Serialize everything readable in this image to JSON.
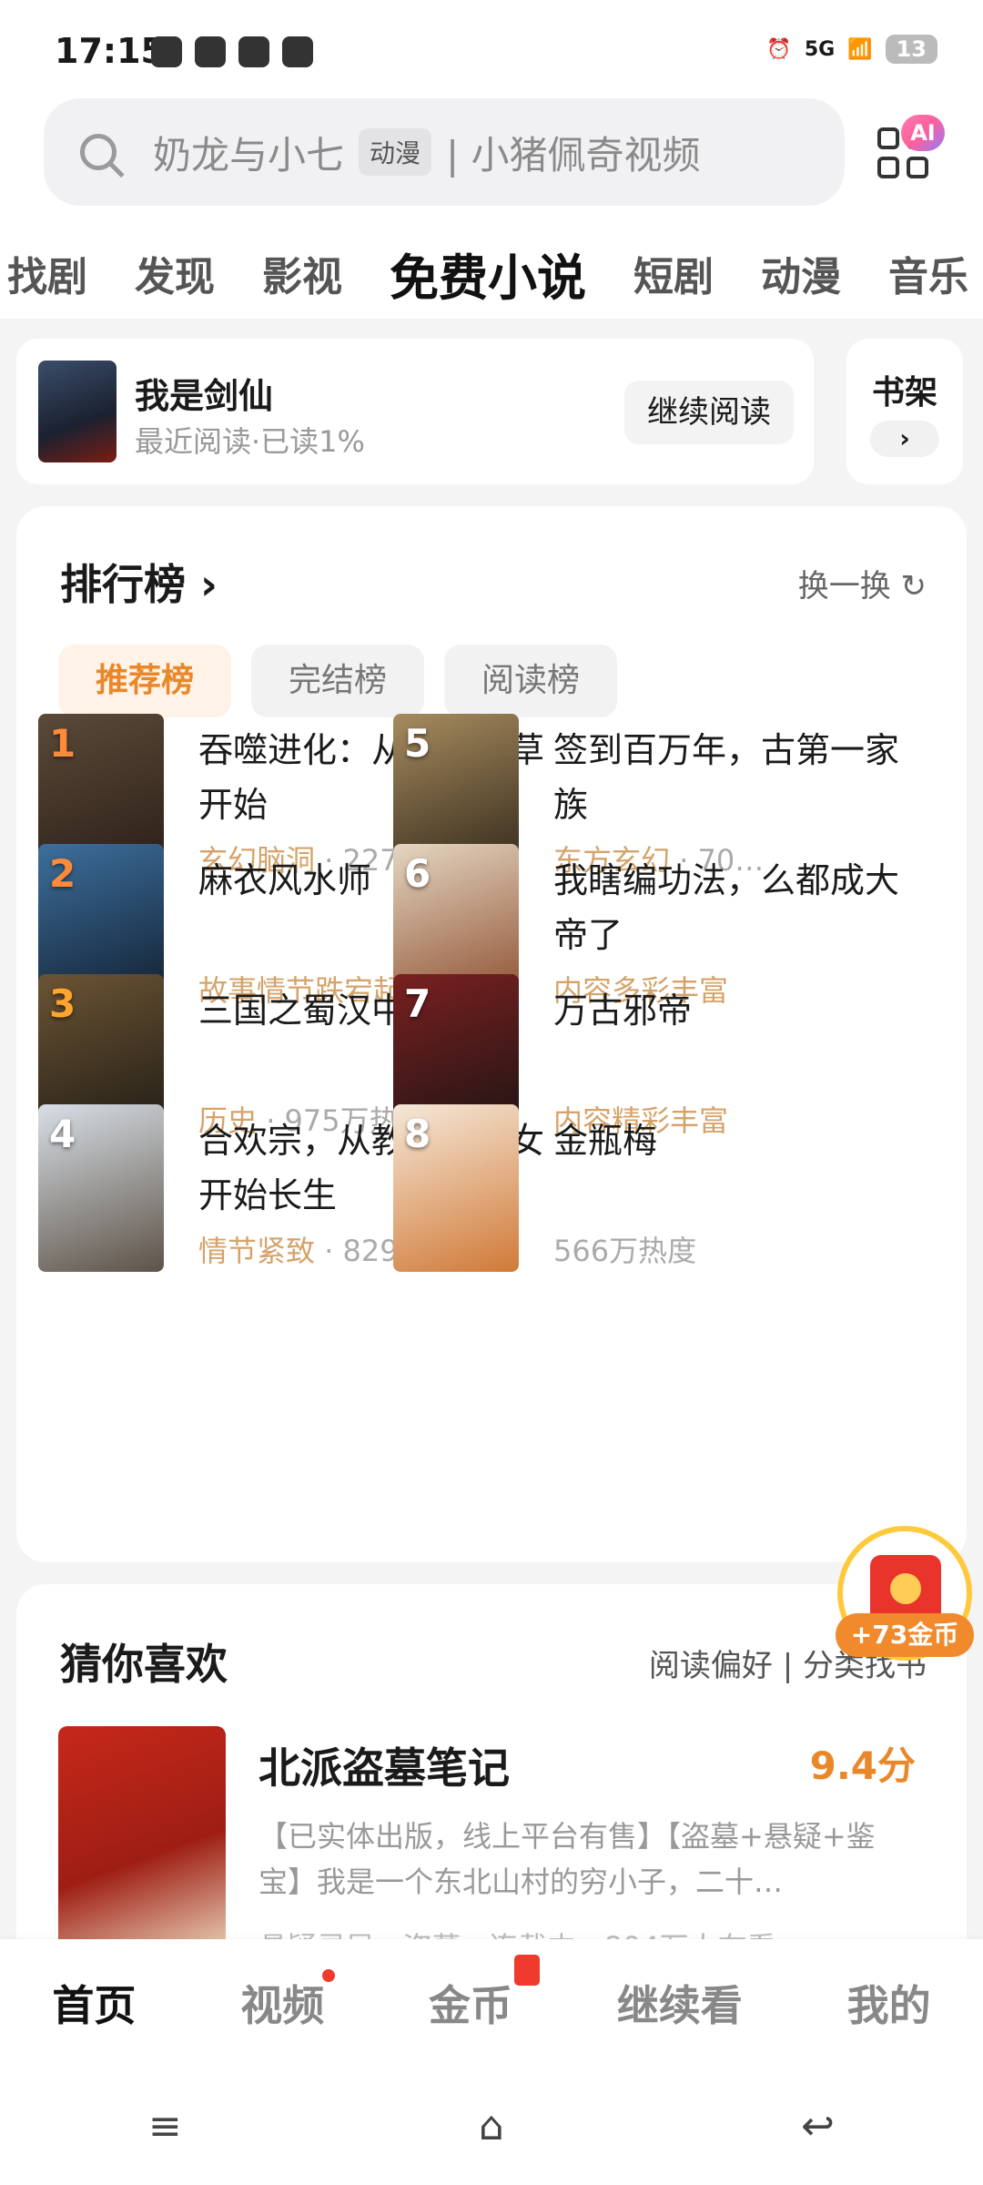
{
  "status_bar": {
    "time": "17:15",
    "network": "5G",
    "battery": "13"
  },
  "search": {
    "query": "奶龙与小七",
    "tag": "动漫",
    "hint": "| 小猪佩奇视频",
    "ai_badge": "AI"
  },
  "tabs": [
    "找剧",
    "发现",
    "影视",
    "免费小说",
    "短剧",
    "动漫",
    "音乐"
  ],
  "continue_reading": {
    "title": "我是剑仙",
    "subtitle": "最近阅读·已读1%",
    "button": "继续阅读"
  },
  "bookshelf": {
    "label": "书架",
    "chevron": "›"
  },
  "ranking": {
    "title": "排行榜 ›",
    "refresh": "换一换 ↻",
    "chips": [
      "推荐榜",
      "完结榜",
      "阅读榜"
    ],
    "books": [
      {
        "num": "1",
        "title": "吞噬进化：从一株杂草开始",
        "genre": "玄幻脑洞",
        "heat": " · 2273万热度",
        "c1": "#5a4a3a",
        "c2": "#2a1c14"
      },
      {
        "num": "2",
        "title": "麻衣风水师",
        "genre": "故事情节跌宕起伏",
        "heat": " · 1…",
        "c1": "#3d6f9c",
        "c2": "#101c2c"
      },
      {
        "num": "3",
        "title": "三国之蜀汉中兴",
        "genre": "历史",
        "heat": " · 975万热度",
        "c1": "#6b5434",
        "c2": "#1e1a14"
      },
      {
        "num": "4",
        "title": "合欢宗，从教训干侄女开始长生",
        "genre": "情节紧致",
        "heat": " · 829万热度",
        "c1": "#d8dfe6",
        "c2": "#5d5348"
      },
      {
        "num": "5",
        "title": "签到百万年，古第一家族",
        "genre": "东方玄幻",
        "heat": " · 70…",
        "c1": "#a68b5e",
        "c2": "#2e2418"
      },
      {
        "num": "6",
        "title": "我瞎编功法，么都成大帝了",
        "genre": "内容多彩丰富",
        "heat": "",
        "c1": "#e4d6c2",
        "c2": "#8a4a2a"
      },
      {
        "num": "7",
        "title": "万古邪帝",
        "genre": "内容精彩丰富",
        "heat": "",
        "c1": "#7a2020",
        "c2": "#1a1414"
      },
      {
        "num": "8",
        "title": "金瓶梅",
        "genre": "",
        "heat": "566万热度",
        "c1": "#f5e8d8",
        "c2": "#d07a38"
      }
    ]
  },
  "guess": {
    "title": "猜你喜欢",
    "links": "阅读偏好  |  分类找书",
    "book": {
      "title": "北派盗墓笔记",
      "score": "9.4分",
      "desc": "【已实体出版，线上平台有售】【盗墓+悬疑+鉴宝】我是一个东北山村的穷小子，二十…",
      "more": "悬疑灵异 · 盗墓 · 连载中 · 804万人在看"
    }
  },
  "coin_float": {
    "label": "+73金币"
  },
  "bottom_nav": [
    "首页",
    "视频",
    "金币",
    "继续看",
    "我的"
  ],
  "system_nav": [
    "≡",
    "⌂",
    "↩"
  ]
}
